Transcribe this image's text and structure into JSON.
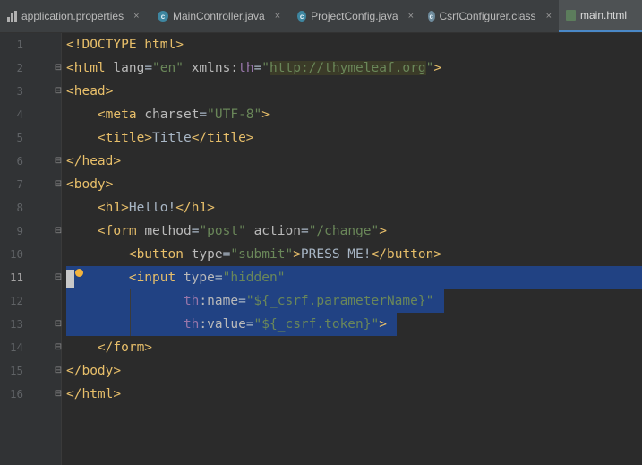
{
  "tabs": [
    {
      "label": "application.properties",
      "icon": "properties-file-icon",
      "active": false
    },
    {
      "label": "MainController.java",
      "icon": "java-class-icon",
      "active": false
    },
    {
      "label": "ProjectConfig.java",
      "icon": "java-class-icon",
      "active": false
    },
    {
      "label": "CsrfConfigurer.class",
      "icon": "compiled-class-icon",
      "active": false
    },
    {
      "label": "main.html",
      "icon": "html-file-icon",
      "active": true
    }
  ],
  "close_glyph": "×",
  "class_glyph": "c",
  "editor": {
    "current_line": 11,
    "line_numbers": [
      "1",
      "2",
      "3",
      "4",
      "5",
      "6",
      "7",
      "8",
      "9",
      "10",
      "11",
      "12",
      "13",
      "14",
      "15",
      "16"
    ],
    "lines": [
      "<!DOCTYPE html>",
      "<html lang=\"en\" xmlns:th=\"http://thymeleaf.org\">",
      "<head>",
      "    <meta charset=\"UTF-8\">",
      "    <title>Title</title>",
      "</head>",
      "<body>",
      "    <h1>Hello!</h1>",
      "    <form method=\"post\" action=\"/change\">",
      "        <button type=\"submit\">PRESS ME!</button>",
      "        <input type=\"hidden\"",
      "               th:name=\"${_csrf.parameterName}\"",
      "               th:value=\"${_csrf.token}\">",
      "    </form>",
      "</body>",
      "</html>"
    ]
  },
  "colors": {
    "background": "#2b2b2b",
    "gutter": "#313335",
    "tab_bar": "#3c3f41",
    "selection": "#214283",
    "tag": "#e8bf6a",
    "attribute": "#bababa",
    "string": "#6a8759",
    "namespace": "#9876aa",
    "active_tab_underline": "#4a88c7"
  }
}
